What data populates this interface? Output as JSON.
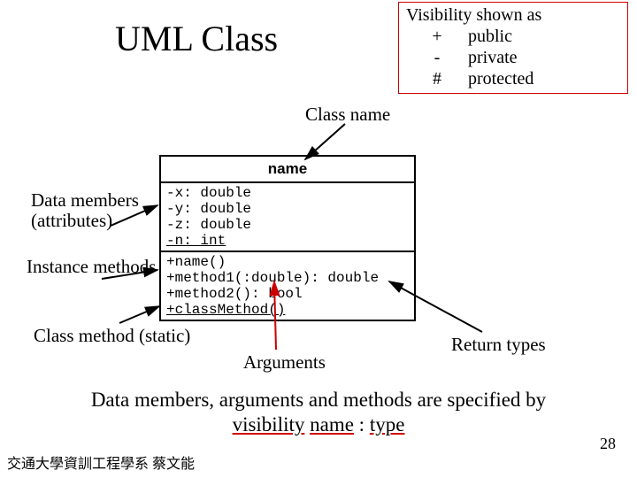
{
  "title": "UML Class",
  "visibility": {
    "heading": "Visibility shown as",
    "rows": [
      {
        "symbol": "+",
        "meaning": "public"
      },
      {
        "symbol": "-",
        "meaning": "private"
      },
      {
        "symbol": "#",
        "meaning": "protected"
      }
    ]
  },
  "labels": {
    "class_name": "Class name",
    "data_members_1": "Data members",
    "data_members_2": "(attributes)",
    "instance_methods": "Instance methods",
    "class_method": "Class method (static)",
    "arguments": "Arguments",
    "return_types": "Return types"
  },
  "uml": {
    "name": "name",
    "attributes": [
      "-x: double",
      "-y: double",
      "-z: double",
      "-n: int"
    ],
    "methods": [
      {
        "text": "+name()",
        "static": false
      },
      {
        "text": "+method1(:double): double",
        "static": false
      },
      {
        "text": "+method2(): bool",
        "static": false
      },
      {
        "text": "+classMethod()",
        "static": true
      }
    ]
  },
  "note": {
    "line1_pre": "Data members, arguments and methods are specified by",
    "visibility": "visibility",
    "name": "name",
    "colon": " : ",
    "type": "type"
  },
  "page_number": "28",
  "footer": "交通大學資訓工程學系 蔡文能"
}
